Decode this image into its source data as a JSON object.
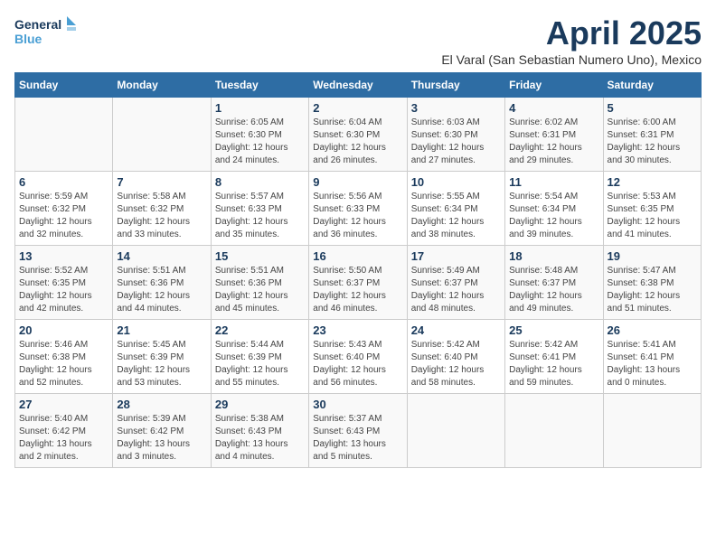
{
  "logo": {
    "line1": "General",
    "line2": "Blue"
  },
  "title": "April 2025",
  "subtitle": "El Varal (San Sebastian Numero Uno), Mexico",
  "days_of_week": [
    "Sunday",
    "Monday",
    "Tuesday",
    "Wednesday",
    "Thursday",
    "Friday",
    "Saturday"
  ],
  "weeks": [
    [
      {
        "day": "",
        "info": ""
      },
      {
        "day": "",
        "info": ""
      },
      {
        "day": "1",
        "sunrise": "Sunrise: 6:05 AM",
        "sunset": "Sunset: 6:30 PM",
        "daylight": "Daylight: 12 hours and 24 minutes."
      },
      {
        "day": "2",
        "sunrise": "Sunrise: 6:04 AM",
        "sunset": "Sunset: 6:30 PM",
        "daylight": "Daylight: 12 hours and 26 minutes."
      },
      {
        "day": "3",
        "sunrise": "Sunrise: 6:03 AM",
        "sunset": "Sunset: 6:30 PM",
        "daylight": "Daylight: 12 hours and 27 minutes."
      },
      {
        "day": "4",
        "sunrise": "Sunrise: 6:02 AM",
        "sunset": "Sunset: 6:31 PM",
        "daylight": "Daylight: 12 hours and 29 minutes."
      },
      {
        "day": "5",
        "sunrise": "Sunrise: 6:00 AM",
        "sunset": "Sunset: 6:31 PM",
        "daylight": "Daylight: 12 hours and 30 minutes."
      }
    ],
    [
      {
        "day": "6",
        "sunrise": "Sunrise: 5:59 AM",
        "sunset": "Sunset: 6:32 PM",
        "daylight": "Daylight: 12 hours and 32 minutes."
      },
      {
        "day": "7",
        "sunrise": "Sunrise: 5:58 AM",
        "sunset": "Sunset: 6:32 PM",
        "daylight": "Daylight: 12 hours and 33 minutes."
      },
      {
        "day": "8",
        "sunrise": "Sunrise: 5:57 AM",
        "sunset": "Sunset: 6:33 PM",
        "daylight": "Daylight: 12 hours and 35 minutes."
      },
      {
        "day": "9",
        "sunrise": "Sunrise: 5:56 AM",
        "sunset": "Sunset: 6:33 PM",
        "daylight": "Daylight: 12 hours and 36 minutes."
      },
      {
        "day": "10",
        "sunrise": "Sunrise: 5:55 AM",
        "sunset": "Sunset: 6:34 PM",
        "daylight": "Daylight: 12 hours and 38 minutes."
      },
      {
        "day": "11",
        "sunrise": "Sunrise: 5:54 AM",
        "sunset": "Sunset: 6:34 PM",
        "daylight": "Daylight: 12 hours and 39 minutes."
      },
      {
        "day": "12",
        "sunrise": "Sunrise: 5:53 AM",
        "sunset": "Sunset: 6:35 PM",
        "daylight": "Daylight: 12 hours and 41 minutes."
      }
    ],
    [
      {
        "day": "13",
        "sunrise": "Sunrise: 5:52 AM",
        "sunset": "Sunset: 6:35 PM",
        "daylight": "Daylight: 12 hours and 42 minutes."
      },
      {
        "day": "14",
        "sunrise": "Sunrise: 5:51 AM",
        "sunset": "Sunset: 6:36 PM",
        "daylight": "Daylight: 12 hours and 44 minutes."
      },
      {
        "day": "15",
        "sunrise": "Sunrise: 5:51 AM",
        "sunset": "Sunset: 6:36 PM",
        "daylight": "Daylight: 12 hours and 45 minutes."
      },
      {
        "day": "16",
        "sunrise": "Sunrise: 5:50 AM",
        "sunset": "Sunset: 6:37 PM",
        "daylight": "Daylight: 12 hours and 46 minutes."
      },
      {
        "day": "17",
        "sunrise": "Sunrise: 5:49 AM",
        "sunset": "Sunset: 6:37 PM",
        "daylight": "Daylight: 12 hours and 48 minutes."
      },
      {
        "day": "18",
        "sunrise": "Sunrise: 5:48 AM",
        "sunset": "Sunset: 6:37 PM",
        "daylight": "Daylight: 12 hours and 49 minutes."
      },
      {
        "day": "19",
        "sunrise": "Sunrise: 5:47 AM",
        "sunset": "Sunset: 6:38 PM",
        "daylight": "Daylight: 12 hours and 51 minutes."
      }
    ],
    [
      {
        "day": "20",
        "sunrise": "Sunrise: 5:46 AM",
        "sunset": "Sunset: 6:38 PM",
        "daylight": "Daylight: 12 hours and 52 minutes."
      },
      {
        "day": "21",
        "sunrise": "Sunrise: 5:45 AM",
        "sunset": "Sunset: 6:39 PM",
        "daylight": "Daylight: 12 hours and 53 minutes."
      },
      {
        "day": "22",
        "sunrise": "Sunrise: 5:44 AM",
        "sunset": "Sunset: 6:39 PM",
        "daylight": "Daylight: 12 hours and 55 minutes."
      },
      {
        "day": "23",
        "sunrise": "Sunrise: 5:43 AM",
        "sunset": "Sunset: 6:40 PM",
        "daylight": "Daylight: 12 hours and 56 minutes."
      },
      {
        "day": "24",
        "sunrise": "Sunrise: 5:42 AM",
        "sunset": "Sunset: 6:40 PM",
        "daylight": "Daylight: 12 hours and 58 minutes."
      },
      {
        "day": "25",
        "sunrise": "Sunrise: 5:42 AM",
        "sunset": "Sunset: 6:41 PM",
        "daylight": "Daylight: 12 hours and 59 minutes."
      },
      {
        "day": "26",
        "sunrise": "Sunrise: 5:41 AM",
        "sunset": "Sunset: 6:41 PM",
        "daylight": "Daylight: 13 hours and 0 minutes."
      }
    ],
    [
      {
        "day": "27",
        "sunrise": "Sunrise: 5:40 AM",
        "sunset": "Sunset: 6:42 PM",
        "daylight": "Daylight: 13 hours and 2 minutes."
      },
      {
        "day": "28",
        "sunrise": "Sunrise: 5:39 AM",
        "sunset": "Sunset: 6:42 PM",
        "daylight": "Daylight: 13 hours and 3 minutes."
      },
      {
        "day": "29",
        "sunrise": "Sunrise: 5:38 AM",
        "sunset": "Sunset: 6:43 PM",
        "daylight": "Daylight: 13 hours and 4 minutes."
      },
      {
        "day": "30",
        "sunrise": "Sunrise: 5:37 AM",
        "sunset": "Sunset: 6:43 PM",
        "daylight": "Daylight: 13 hours and 5 minutes."
      },
      {
        "day": "",
        "info": ""
      },
      {
        "day": "",
        "info": ""
      },
      {
        "day": "",
        "info": ""
      }
    ]
  ]
}
